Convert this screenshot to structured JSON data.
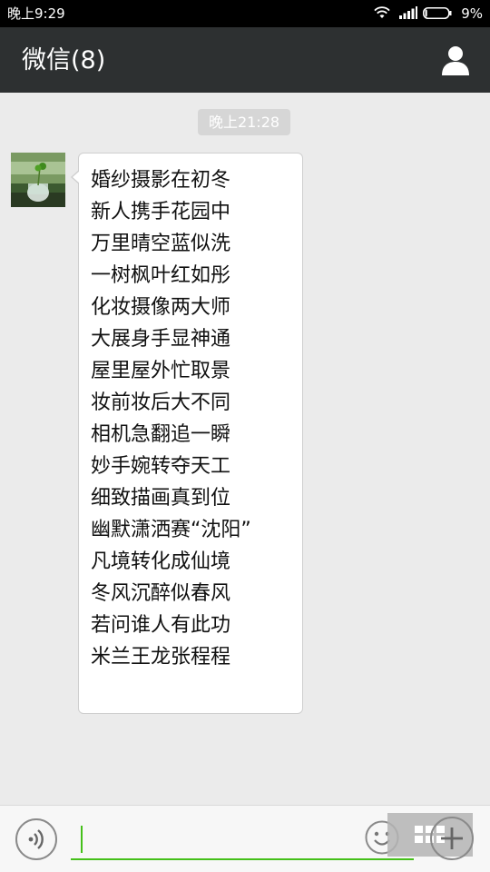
{
  "status_bar": {
    "time": "晚上9:29",
    "battery_percent": "9%",
    "battery_level": 0.09
  },
  "header": {
    "title": "微信(8)",
    "contact_icon": "person-icon"
  },
  "chat": {
    "timestamp": "晚上21:28",
    "message": {
      "lines": [
        "婚纱摄影在初冬",
        "新人携手花园中",
        "万里晴空蓝似洗",
        "一树枫叶红如彤",
        "化妆摄像两大师",
        "大展身手显神通",
        "屋里屋外忙取景",
        "妆前妆后大不同",
        "相机急翻追一瞬",
        "妙手婉转夺天工",
        "细致描画真到位",
        "幽默潇洒赛“沈阳”",
        "凡境转化成仙境",
        "冬风沉醉似春风",
        "若问谁人有此功",
        "米兰王龙张程程"
      ]
    }
  },
  "input_bar": {
    "voice_icon": "voice-icon",
    "text_value": "",
    "emoji_icon": "emoji-icon",
    "grid_icon": "grid-icon",
    "plus_icon": "plus-icon",
    "accent_color": "#45c01a"
  }
}
